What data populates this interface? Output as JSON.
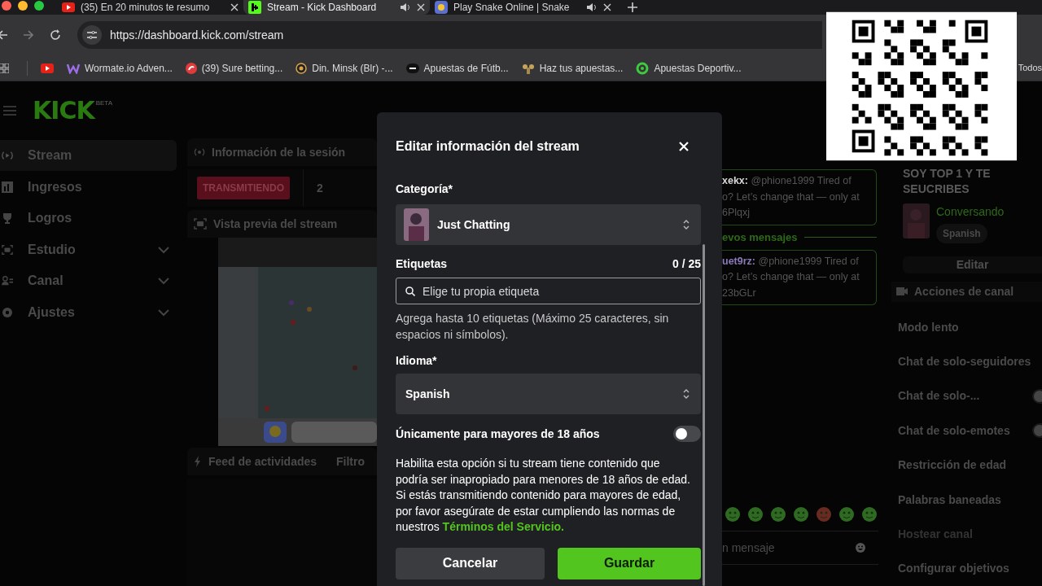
{
  "browser": {
    "tabs": [
      {
        "title": "(35) En 20 minutos te resumo",
        "selected": false,
        "audio": false
      },
      {
        "title": "Stream - Kick Dashboard",
        "selected": true,
        "audio": true
      },
      {
        "title": "Play Snake Online | Snake",
        "selected": false,
        "audio": true
      }
    ],
    "url": "https://dashboard.kick.com/stream",
    "bookmarks": [
      "Wormate.io Adven...",
      "(39) Sure betting...",
      "Din. Minsk (Blr) -...",
      "Apuestas de Fútb...",
      "Haz tus apuestas...",
      "Apuestas Deportiv..."
    ],
    "bookmarks_overflow": "Todos"
  },
  "logo": {
    "text": "KICK",
    "badge": "BETA"
  },
  "sidebar": {
    "items": [
      {
        "label": "Stream",
        "selected": true,
        "expandable": false
      },
      {
        "label": "Ingresos",
        "selected": false,
        "expandable": false
      },
      {
        "label": "Logros",
        "selected": false,
        "expandable": false
      },
      {
        "label": "Estudio",
        "selected": false,
        "expandable": true
      },
      {
        "label": "Canal",
        "selected": false,
        "expandable": true
      },
      {
        "label": "Ajustes",
        "selected": false,
        "expandable": true
      }
    ]
  },
  "session": {
    "title": "Información de la sesión",
    "status": "TRANSMITIENDO",
    "count": "2"
  },
  "preview": {
    "title": "Vista previa del stream"
  },
  "feed": {
    "title": "Feed de actividades",
    "filter": "Filtro"
  },
  "chat": {
    "messages": [
      {
        "user": "xekx:",
        "color": "#d8d8d8",
        "lines": [
          "@phione1999 Tired of",
          "o? Let’s change that — only at",
          "6Plqxj"
        ]
      },
      {
        "divider": "evos mensajes"
      },
      {
        "user": "uet9rz:",
        "color": "#8a7ab8",
        "lines": [
          "@phione1999 Tired of",
          "o? Let’s change that — only at",
          "23bGLr"
        ]
      }
    ],
    "input_placeholder": "n mensaje"
  },
  "stream_info": {
    "title": "SOY TOP 1 Y TE SEUCRIBES",
    "category": "Conversando",
    "language": "Spanish",
    "edit": "Editar"
  },
  "channel_actions": {
    "title": "Acciones de canal",
    "items": [
      {
        "label": "Modo lento",
        "kind": "plain",
        "disabled": false
      },
      {
        "label": "Chat de solo-seguidores",
        "kind": "plain",
        "disabled": false
      },
      {
        "label": "Chat de solo-...",
        "kind": "toggle",
        "on": false,
        "disabled": false
      },
      {
        "label": "Chat de solo-emotes",
        "kind": "toggle",
        "on": false,
        "disabled": false
      },
      {
        "label": "Restricción de edad",
        "kind": "plain",
        "disabled": false
      },
      {
        "label": "Palabras baneadas",
        "kind": "plain",
        "disabled": false
      },
      {
        "label": "Hostear canal",
        "kind": "plain",
        "disabled": true
      },
      {
        "label": "Configurar objetivos",
        "kind": "plain",
        "disabled": false
      }
    ]
  },
  "modal": {
    "title": "Editar información del stream",
    "category_label": "Categoría*",
    "category": "Just Chatting",
    "tags_label": "Etiquetas",
    "tags_count": "0 / 25",
    "tags_placeholder": "Elige tu propia etiqueta",
    "tags_help": "Agrega hasta 10 etiquetas (Máximo 25 caracteres, sin espacios ni símbolos).",
    "language_label": "Idioma*",
    "language": "Spanish",
    "mature_label": "Únicamente para mayores de 18 años",
    "mature_on": false,
    "mature_help": "Habilita esta opción si tu stream tiene contenido que podría ser inapropiado para menores de 18 años de edad. Si estás transmitiendo contenido para mayores de edad, por favor asegúrate de estar cumpliendo las normas de nuestros ",
    "terms_link": "Términos del Servicio.",
    "cancel": "Cancelar",
    "save": "Guardar"
  }
}
